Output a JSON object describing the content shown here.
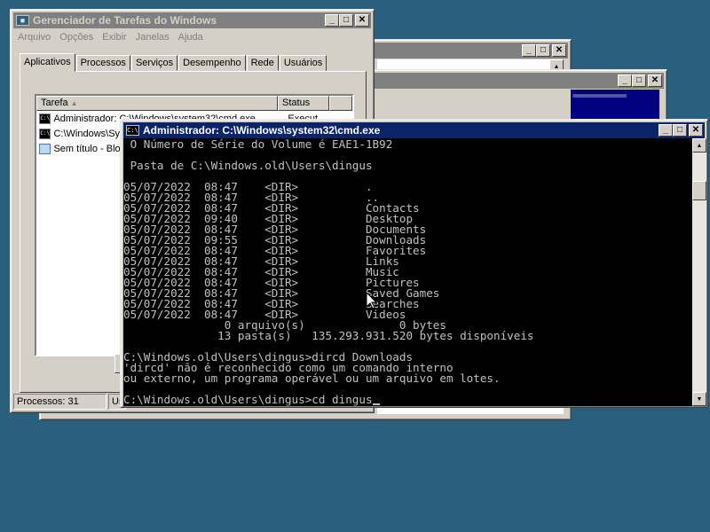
{
  "background_windows": {
    "bg2_console_text": "============"
  },
  "taskman": {
    "title": "Gerenciador de Tarefas do Windows",
    "menu": [
      "Arquivo",
      "Opções",
      "Exibir",
      "Janelas",
      "Ajuda"
    ],
    "tabs": [
      "Aplicativos",
      "Processos",
      "Serviços",
      "Desempenho",
      "Rede",
      "Usuários"
    ],
    "selected_tab": "Aplicativos",
    "columns": {
      "task": "Tarefa",
      "status": "Status"
    },
    "rows": [
      {
        "task": "Administrador: C:\\Windows\\system32\\cmd.exe",
        "status": "Execut...",
        "icon": "cmd-icon"
      },
      {
        "task": "C:\\Windows\\Sy",
        "status": "",
        "icon": "cmd-icon"
      },
      {
        "task": "Sem título - Blo",
        "status": "",
        "icon": "notepad-icon"
      }
    ],
    "status": {
      "processes": "Processos: 31",
      "usage": "Us"
    }
  },
  "cmd": {
    "title": "Administrador: C:\\Windows\\system32\\cmd.exe",
    "lines": [
      " O Número de Série do Volume é EAE1-1B92",
      "",
      " Pasta de C:\\Windows.old\\Users\\dingus",
      "",
      "05/07/2022  08:47    <DIR>          .",
      "05/07/2022  08:47    <DIR>          ..",
      "05/07/2022  08:47    <DIR>          Contacts",
      "05/07/2022  09:40    <DIR>          Desktop",
      "05/07/2022  08:47    <DIR>          Documents",
      "05/07/2022  09:55    <DIR>          Downloads",
      "05/07/2022  08:47    <DIR>          Favorites",
      "05/07/2022  08:47    <DIR>          Links",
      "05/07/2022  08:47    <DIR>          Music",
      "05/07/2022  08:47    <DIR>          Pictures",
      "05/07/2022  08:47    <DIR>          Saved Games",
      "05/07/2022  08:47    <DIR>          Searches",
      "05/07/2022  08:47    <DIR>          Videos",
      "               0 arquivo(s)              0 bytes",
      "              13 pasta(s)   135.293.931.520 bytes disponíveis",
      "",
      "C:\\Windows.old\\Users\\dingus>dircd Downloads",
      "'dircd' não é reconhecido como um comando interno",
      "ou externo, um programa operável ou um arquivo em lotes.",
      "",
      "C:\\Windows.old\\Users\\dingus>cd dingus"
    ]
  }
}
